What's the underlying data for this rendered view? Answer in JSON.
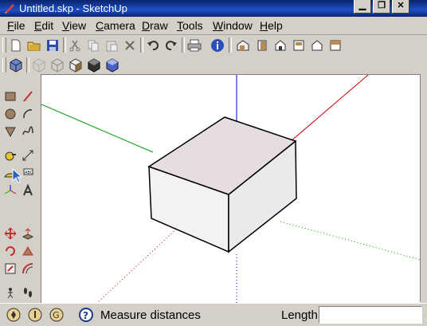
{
  "window": {
    "title": "Untitled.skp - SketchUp"
  },
  "menu": [
    "File",
    "Edit",
    "View",
    "Camera",
    "Draw",
    "Tools",
    "Window",
    "Help"
  ],
  "toolbar1": [
    "new-icon",
    "open-icon",
    "save-icon",
    "cut-icon",
    "copy-icon",
    "paste-icon",
    "erase-icon",
    "undo-icon",
    "redo-icon",
    "print-icon",
    "model-info-icon",
    "iso-view-icon",
    "front-view-icon",
    "right-view-icon",
    "back-view-icon",
    "left-view-icon",
    "top-view-icon"
  ],
  "toolbar2": [
    "iso-icon",
    "xray-icon",
    "wireframe-icon",
    "hidden-line-icon",
    "shaded-icon",
    "shaded-textures-icon"
  ],
  "status": {
    "hint": "Measure distances",
    "length_label": "Length",
    "length_value": ""
  },
  "colors": {
    "accent": "#0a246a",
    "red_axis": "#cc0000",
    "green_axis": "#009900",
    "blue_axis": "#0000cc"
  }
}
